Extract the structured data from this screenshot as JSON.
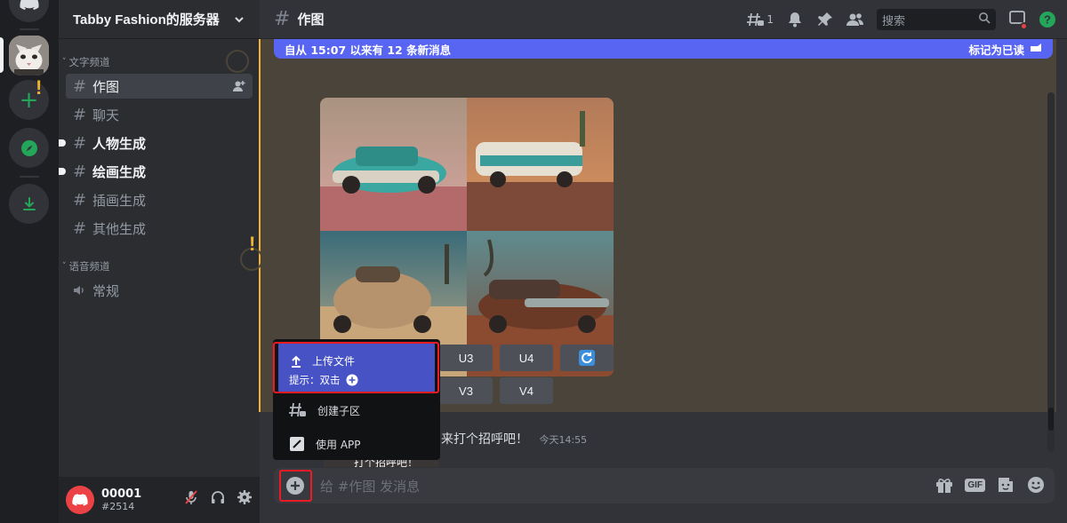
{
  "server": {
    "name": "Tabby Fashion的服务器",
    "categories": {
      "text": "文字频道",
      "voice": "语音频道"
    },
    "channels": [
      {
        "name": "作图",
        "state": "active"
      },
      {
        "name": "聊天",
        "state": "muted"
      },
      {
        "name": "人物生成",
        "state": "unread"
      },
      {
        "name": "绘画生成",
        "state": "unread"
      },
      {
        "name": "插画生成",
        "state": "muted"
      },
      {
        "name": "其他生成",
        "state": "muted"
      }
    ],
    "voice_channels": [
      {
        "name": "常规"
      }
    ]
  },
  "user": {
    "name": "00001",
    "tag": "#2514"
  },
  "header": {
    "channel": "作图",
    "threads_count": "1",
    "search_placeholder": "搜索"
  },
  "new_messages_bar": {
    "text": "自从 15:07 以来有 12 条新消息",
    "action": "标记为已读"
  },
  "upscale_buttons": {
    "row1": [
      "U3",
      "U4"
    ],
    "row2": [
      "V3",
      "V4"
    ]
  },
  "popup": {
    "upload_label": "上传文件",
    "hint_label": "提示：双击",
    "create_thread": "创建子区",
    "use_app": "使用 APP"
  },
  "welcome": {
    "text": "来打个招呼吧！",
    "time": "今天14:55",
    "peek": "打个招呼吧！"
  },
  "composer": {
    "placeholder": "给 #作图 发消息",
    "gif_label": "GIF"
  },
  "colors": {
    "accent": "#5865f2",
    "highlight": "#ed1c24",
    "alert": "#f0b232",
    "success": "#23a55a"
  }
}
